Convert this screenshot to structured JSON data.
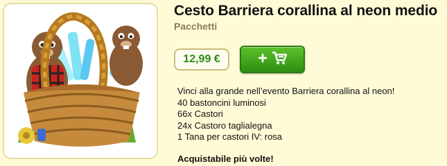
{
  "product": {
    "title": "Cesto Barriera corallina al neon medio",
    "category": "Pacchetti",
    "image_icon": "beaver-basket-bundle",
    "price": "12,99 €",
    "buy_button_icon": "add-to-cart-icon",
    "description_lines": [
      "Vinci alla grande nell’evento Barriera corallina al neon!",
      "40 bastoncini luminosi",
      "66x Castori",
      "24x Castoro taglialegna",
      "1 Tana per castori IV: rosa"
    ],
    "purchasable_note": "Acquistabile più volte!"
  },
  "colors": {
    "background": "#fffbd6",
    "price_text": "#2e8b14",
    "buy_button": "#3fa31a",
    "category_text": "#8a7a5a"
  }
}
